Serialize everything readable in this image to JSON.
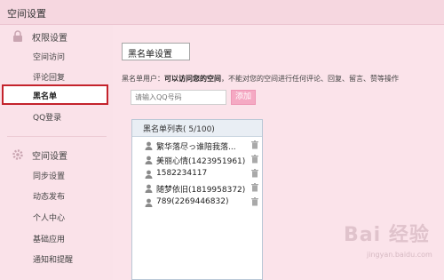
{
  "window": {
    "title": "空间设置"
  },
  "sidebar": {
    "sections": [
      {
        "label": "权限设置",
        "icon": "lock-icon",
        "items": [
          {
            "label": "空间访问"
          },
          {
            "label": "评论回复"
          },
          {
            "label": "黑名单",
            "active": true
          },
          {
            "label": "QQ登录"
          }
        ]
      },
      {
        "label": "空间设置",
        "icon": "gear-icon",
        "items": [
          {
            "label": "同步设置"
          },
          {
            "label": "动态发布"
          },
          {
            "label": "个人中心"
          },
          {
            "label": "基础应用"
          },
          {
            "label": "通知和提醒"
          }
        ]
      }
    ]
  },
  "main": {
    "panel_title": "黑名单设置",
    "description_prefix": "黑名单用户：",
    "description_bold": "可以访问您的空间",
    "description_suffix": "，不能对您的空间进行任何评论、回复、留言、赞等操作",
    "search_placeholder": "请输入QQ号码",
    "add_label": "添加",
    "list": {
      "header": "黑名单列表( 5/100)",
      "entries": [
        {
          "name": "繁华落尽っ谁陪我落..."
        },
        {
          "name": "美丽心情(1423951961)"
        },
        {
          "name": "1582234117"
        },
        {
          "name": "随梦依旧(1819958372)"
        },
        {
          "name": "789(2269446832)"
        }
      ]
    }
  },
  "watermark": {
    "brand": "Bai 经验",
    "url": "jingyan.baidu.com"
  },
  "colors": {
    "active_border": "#c4232c",
    "add_button": "#f5a9c3",
    "background": "#fbe3ea"
  }
}
